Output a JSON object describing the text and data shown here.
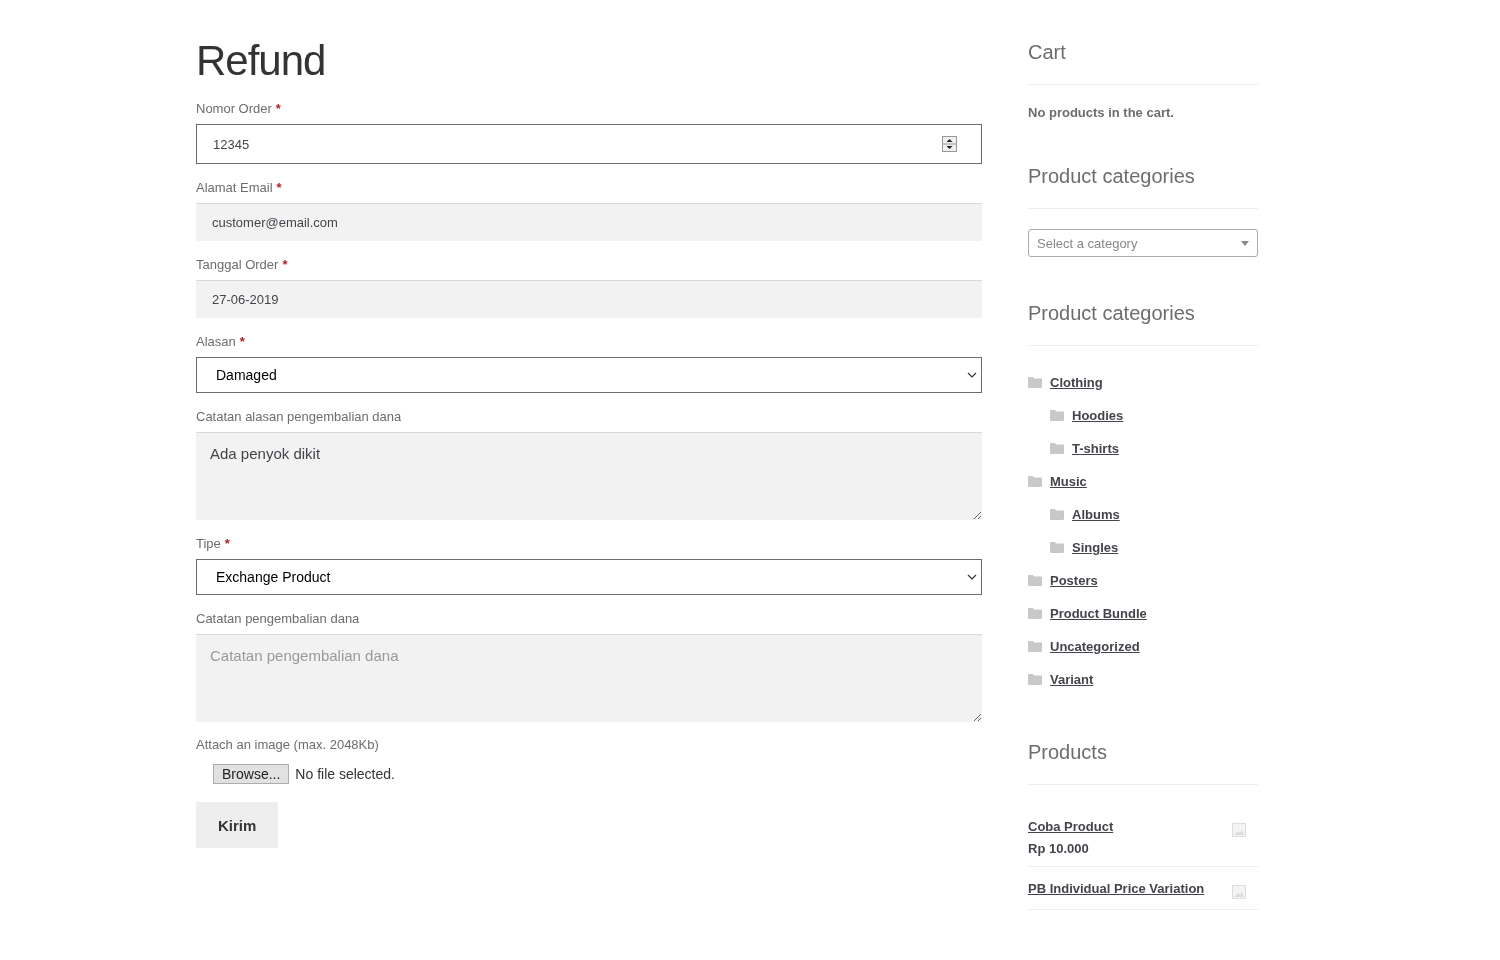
{
  "page_title": "Refund",
  "form": {
    "fields": [
      {
        "kind": "number",
        "label": "Nomor Order",
        "required_mark": "*",
        "value": "12345"
      },
      {
        "kind": "text",
        "label": "Alamat Email",
        "required_mark": "*",
        "value": "customer@email.com"
      },
      {
        "kind": "text",
        "label": "Tanggal Order",
        "required_mark": "*",
        "value": "27-06-2019"
      },
      {
        "kind": "select",
        "label": "Alasan",
        "required_mark": "*",
        "value": "Damaged"
      },
      {
        "kind": "textarea",
        "label": "Catatan alasan pengembalian dana",
        "value": "Ada penyok dikit"
      },
      {
        "kind": "select",
        "label": "Tipe",
        "required_mark": "*",
        "value": "Exchange Product"
      },
      {
        "kind": "textarea",
        "label": "Catatan pengembalian dana",
        "placeholder": "Catatan pengembalian dana"
      }
    ],
    "attachment": {
      "label": "Attach an image (max. 2048Kb)",
      "button": "Browse...",
      "status": "No file selected."
    },
    "submit": "Kirim"
  },
  "sidebar": {
    "widgets": [
      {
        "kind": "message",
        "title": "Cart",
        "text": "No products in the cart."
      },
      {
        "kind": "dropdown",
        "title": "Product categories",
        "placeholder": "Select a category"
      },
      {
        "kind": "tree",
        "title": "Product categories",
        "items": [
          {
            "label": "Clothing",
            "children": [
              {
                "label": "Hoodies"
              },
              {
                "label": "T-shirts"
              }
            ]
          },
          {
            "label": "Music",
            "children": [
              {
                "label": "Albums"
              },
              {
                "label": "Singles"
              }
            ]
          },
          {
            "label": "Posters"
          },
          {
            "label": "Product Bundle"
          },
          {
            "label": "Uncategorized"
          },
          {
            "label": "Variant"
          }
        ]
      },
      {
        "kind": "products",
        "title": "Products",
        "items": [
          {
            "name": "Coba Product",
            "price": "Rp 10.000"
          },
          {
            "name": "PB Individual Price Variation"
          }
        ]
      }
    ]
  }
}
